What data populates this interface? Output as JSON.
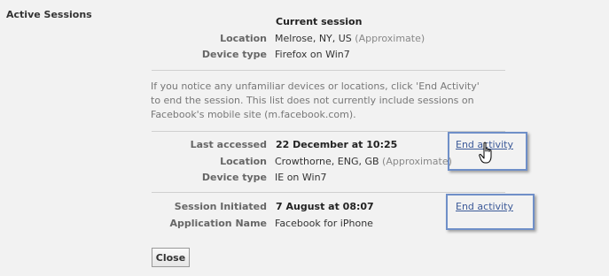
{
  "section": {
    "title": "Active Sessions"
  },
  "current": {
    "heading": "Current session",
    "location_label": "Location",
    "location_value": "Melrose, NY, US",
    "location_note": "(Approximate)",
    "device_label": "Device type",
    "device_value": "Firefox on Win7"
  },
  "notice": "If you notice any unfamiliar devices or locations, click 'End Activity' to end the session. This list does not currently include sessions on Facebook's mobile site (m.facebook.com).",
  "session1": {
    "accessed_label": "Last accessed",
    "accessed_value": "22 December at 10:25",
    "location_label": "Location",
    "location_value": "Crowthorne, ENG, GB",
    "location_note": "(Approximate)",
    "device_label": "Device type",
    "device_value": "IE on Win7",
    "end_label": "End activity"
  },
  "session2": {
    "initiated_label": "Session Initiated",
    "initiated_value": "7 August at 08:07",
    "app_label": "Application Name",
    "app_value": "Facebook for iPhone",
    "end_label": "End activity"
  },
  "close_label": "Close",
  "icons": {
    "cursor": "hand-pointer-icon"
  }
}
